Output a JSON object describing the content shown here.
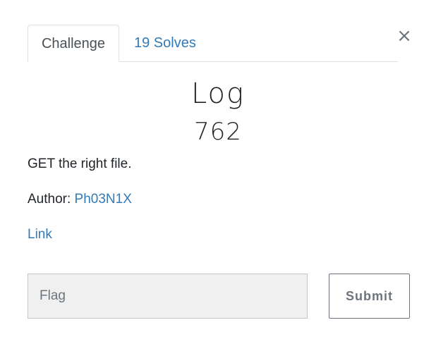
{
  "modal": {
    "close_glyph": "×",
    "tabs": [
      {
        "label": "Challenge",
        "active": true
      },
      {
        "label": "19 Solves",
        "active": false
      }
    ],
    "challenge": {
      "name": "Log",
      "value": "762",
      "description": "GET the right file.",
      "author_label": "Author: ",
      "author_name": "Ph03N1X",
      "link_label": "Link"
    },
    "submission": {
      "flag_placeholder": "Flag",
      "flag_value": "",
      "submit_label": "Submit"
    },
    "colors": {
      "link": "#337ab7",
      "text": "#212529",
      "input_bg": "#f0f0f0",
      "muted": "#6c757d"
    }
  }
}
